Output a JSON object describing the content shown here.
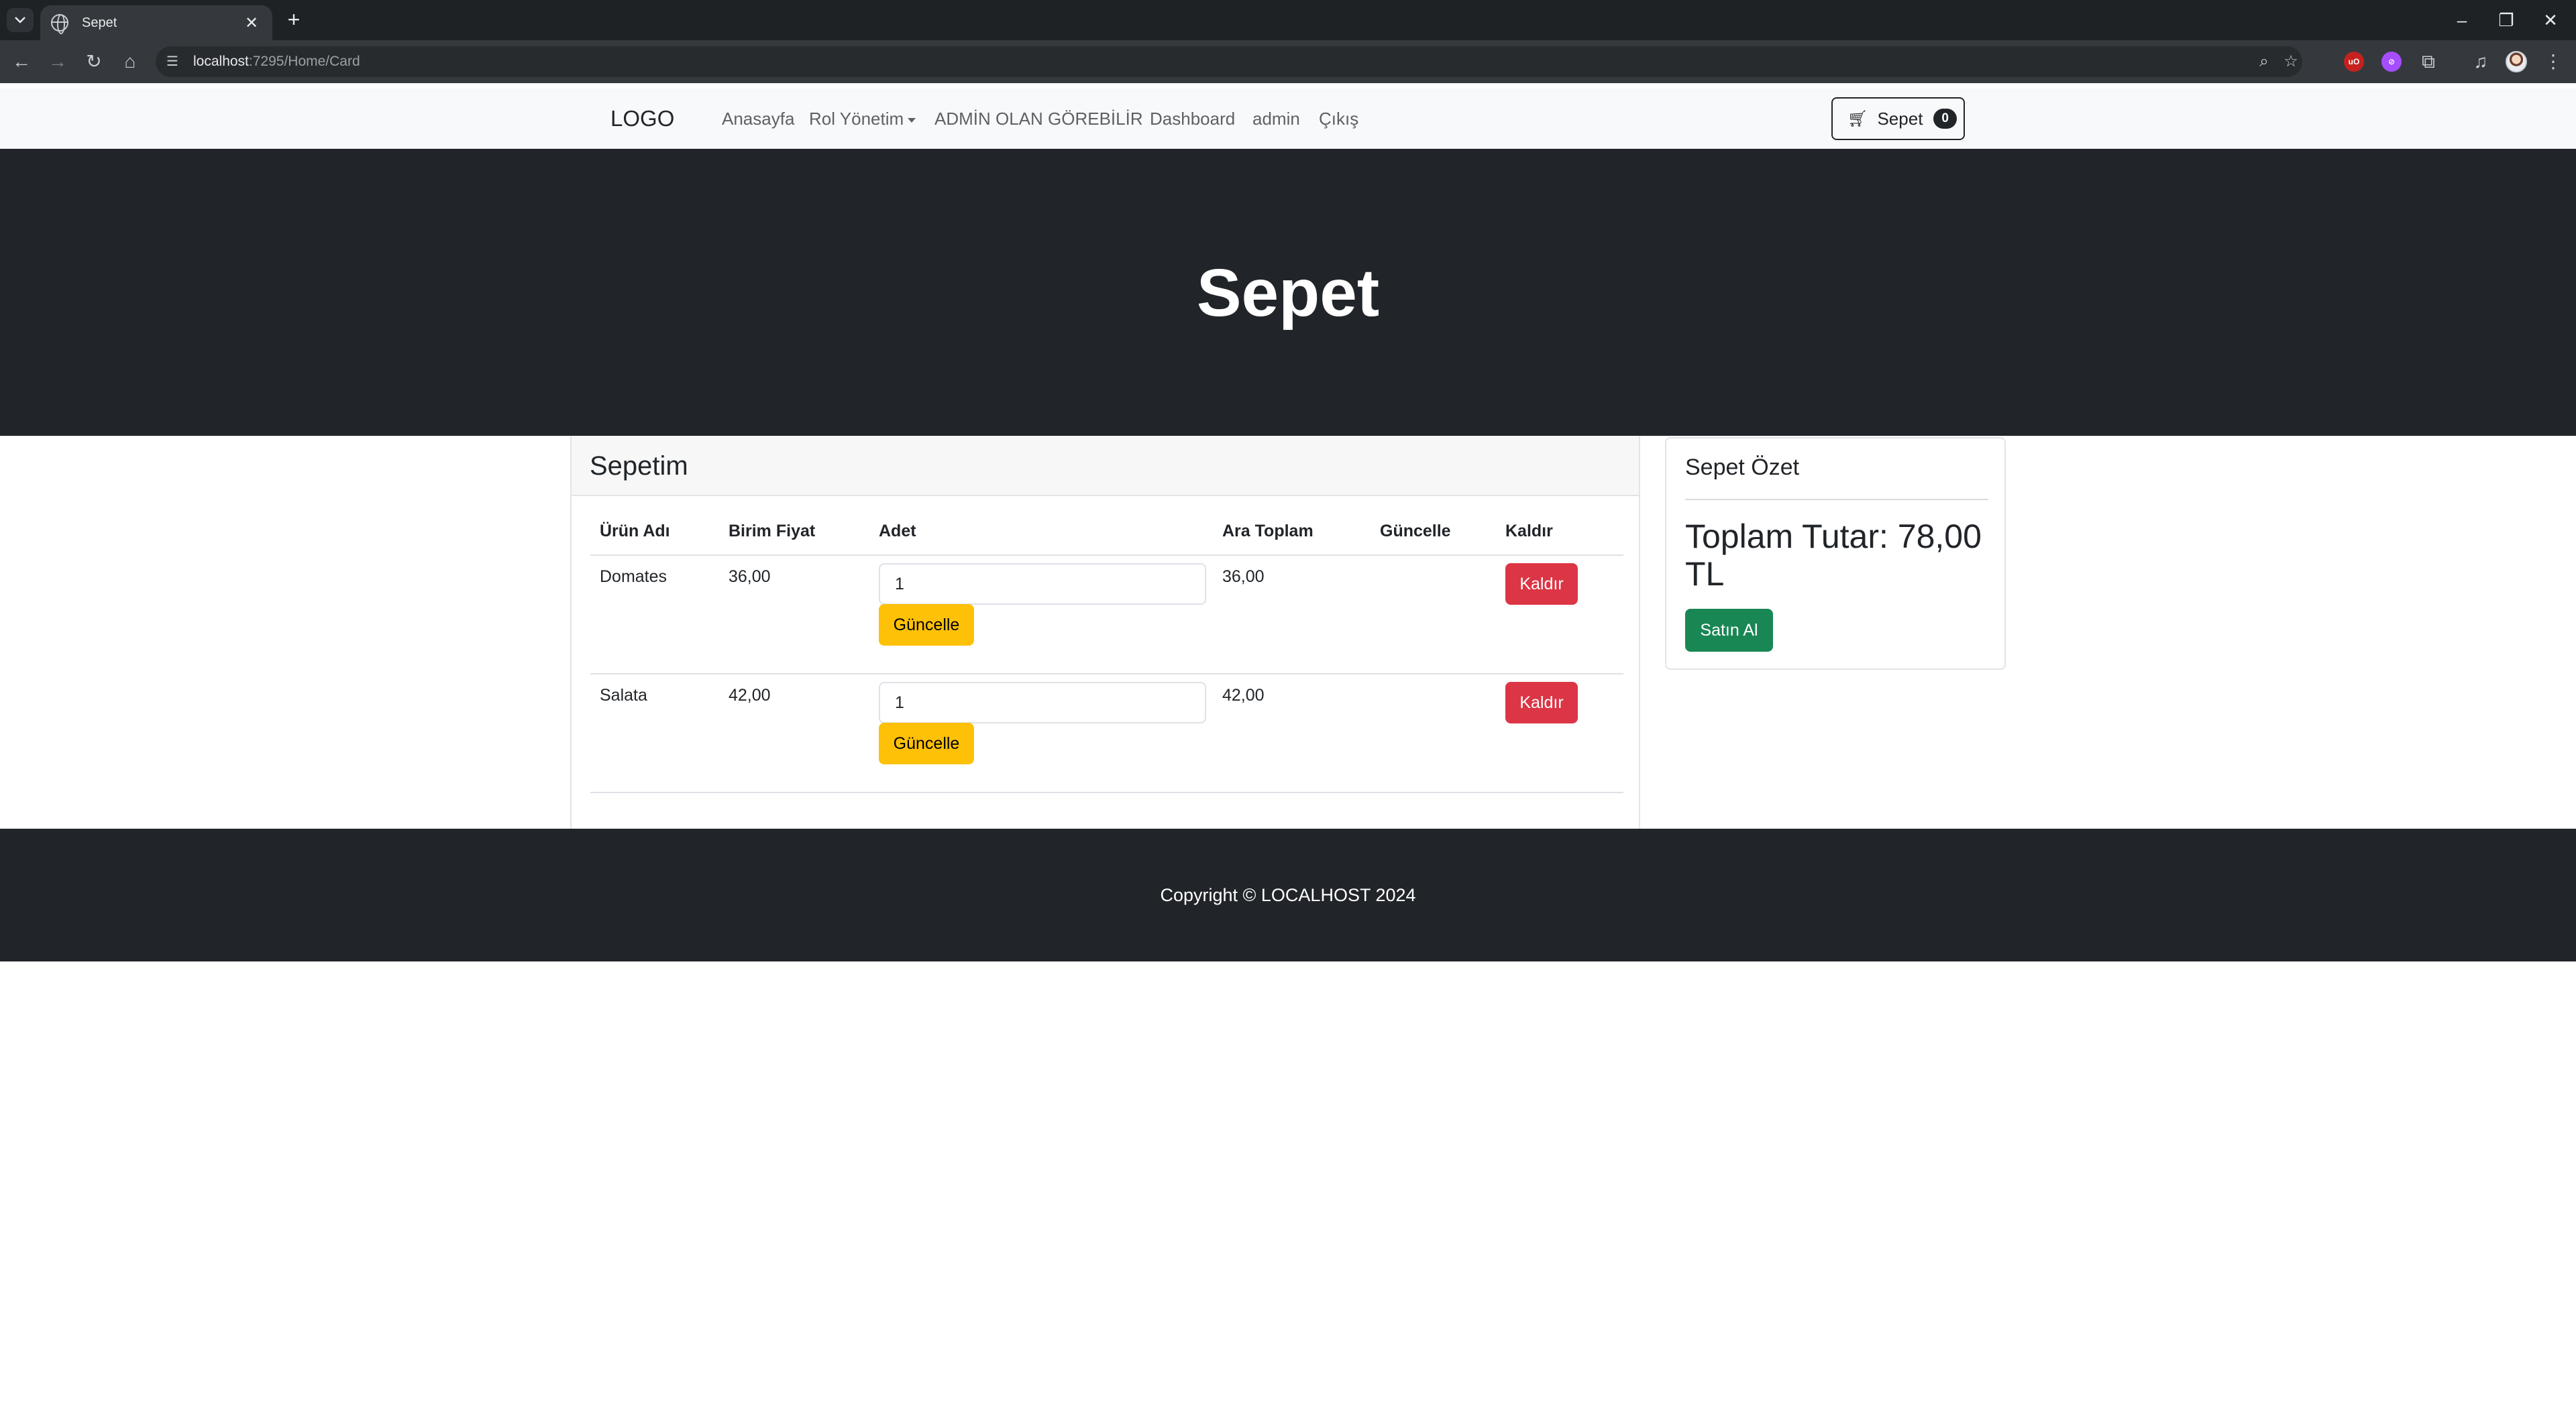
{
  "browser": {
    "tab_title": "Sepet",
    "url_host": "localhost",
    "url_rest": ":7295/Home/Card",
    "icons": [
      "tab-search-icon",
      "globe-icon",
      "close-icon",
      "plus-icon",
      "back-icon",
      "forward-icon",
      "reload-icon",
      "home-icon",
      "site-info-icon",
      "zoom-icon",
      "star-icon",
      "extensions-icon",
      "media-icon",
      "avatar",
      "menu-icon"
    ],
    "extension_colors": [
      "#c5221f",
      "#a64dff"
    ]
  },
  "navbar": {
    "brand": "LOGO",
    "links": [
      "Anasayfa",
      "Rol Yönetim",
      "ADMİN OLAN GÖREBİLİR",
      "Dashboard",
      "admin",
      "Çıkış"
    ],
    "cart_label": "Sepet",
    "cart_count": "0"
  },
  "hero": {
    "title": "Sepet"
  },
  "cart": {
    "title": "Sepetim",
    "columns": [
      "Ürün Adı",
      "Birim Fiyat",
      "Adet",
      "Ara Toplam",
      "Güncelle",
      "Kaldır"
    ],
    "rows": [
      {
        "name": "Domates",
        "unit_price": "36,00",
        "quantity": "1",
        "subtotal": "36,00",
        "update_label": "Güncelle",
        "remove_label": "Kaldır"
      },
      {
        "name": "Salata",
        "unit_price": "42,00",
        "quantity": "1",
        "subtotal": "42,00",
        "update_label": "Güncelle",
        "remove_label": "Kaldır"
      }
    ]
  },
  "summary": {
    "title": "Sepet Özet",
    "total": "Toplam Tutar: 78,00 TL",
    "buy_label": "Satın Al"
  },
  "footer": {
    "text": "Copyright © LOCALHOST 2024"
  },
  "colors": {
    "dark": "#212529",
    "warning": "#ffc107",
    "danger": "#dc3545",
    "success": "#198754"
  }
}
